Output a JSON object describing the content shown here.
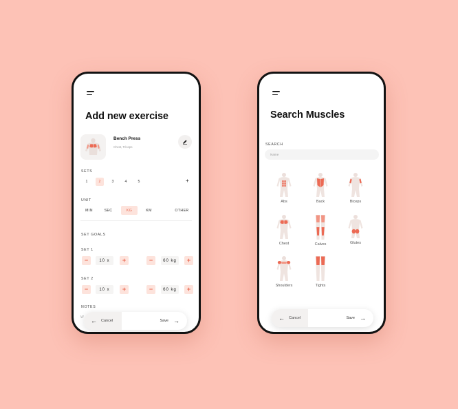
{
  "colors": {
    "background": "#fdc2b6",
    "accent": "#ea6a52",
    "accent_light": "#fde3dc"
  },
  "screen1": {
    "title": "Add new exercise",
    "exercise": {
      "name": "Bench Press",
      "subtitle": "Chest, Triceps"
    },
    "sets": {
      "label": "SETS",
      "options": [
        "1",
        "2",
        "3",
        "4",
        "5"
      ],
      "selected": "2",
      "add": "+"
    },
    "unit": {
      "label": "UNIT",
      "options": [
        "MIN",
        "SEC",
        "KG",
        "KM",
        "OTHER"
      ],
      "selected": "KG"
    },
    "goals": {
      "label": "SET GOALS",
      "sets": [
        {
          "label": "SET 1",
          "reps": "10 x",
          "weight": "60 kg"
        },
        {
          "label": "SET 2",
          "reps": "10 x",
          "weight": "60 kg"
        }
      ]
    },
    "notes": {
      "label": "NOTES",
      "value": "W"
    },
    "actions": {
      "cancel": "Cancel",
      "save": "Save"
    }
  },
  "screen2": {
    "title": "Search Muscles",
    "search": {
      "label": "SEARCH",
      "placeholder": "Name"
    },
    "muscles": [
      "Abs",
      "Back",
      "Biceps",
      "Chest",
      "Calves",
      "Glutes",
      "Shoulders",
      "Tights"
    ],
    "actions": {
      "cancel": "Cancel",
      "save": "Save"
    }
  }
}
